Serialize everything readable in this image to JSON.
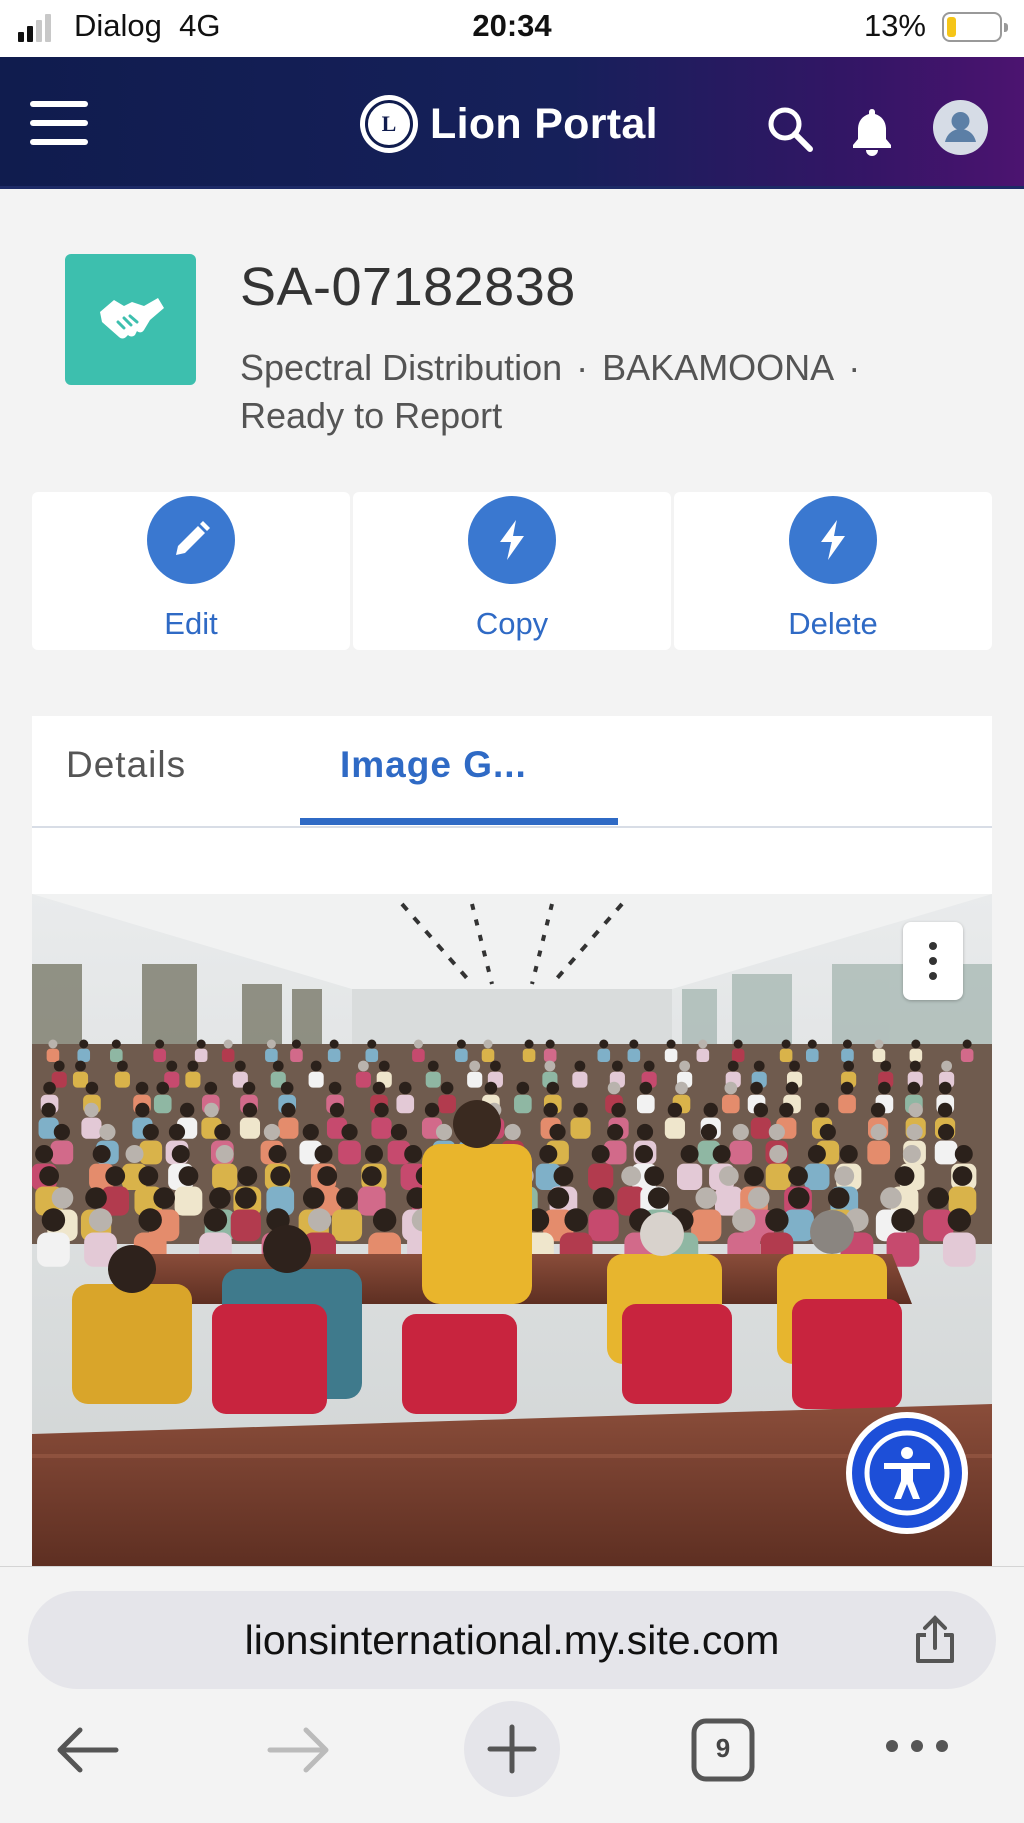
{
  "status_bar": {
    "carrier": "Dialog",
    "network": "4G",
    "time": "20:34",
    "battery": "13%",
    "battery_level": 0.13
  },
  "header": {
    "title": "Lion Portal",
    "logo_letter": "L",
    "icons": [
      "menu-icon",
      "search-icon",
      "bell-icon",
      "user-avatar-icon"
    ]
  },
  "record": {
    "icon": "handshake-icon",
    "icon_color": "#3dbfae",
    "id": "SA-07182838",
    "type": "Spectral Distribution",
    "location": "BAKAMOONA",
    "status": "Ready to Report",
    "separator": "·"
  },
  "actions": [
    {
      "label": "Edit",
      "icon": "pencil-icon"
    },
    {
      "label": "Copy",
      "icon": "lightning-icon"
    },
    {
      "label": "Delete",
      "icon": "lightning-icon"
    }
  ],
  "tabs": [
    {
      "label": "Details",
      "active": false
    },
    {
      "label": "Image G...",
      "active": true
    }
  ],
  "gallery": {
    "image_alt": "Group photo in a hall with seated audience and Lions members at a front table",
    "menu_icon": "more-vertical-icon"
  },
  "accessibility_button": {
    "icon": "accessibility-icon"
  },
  "browser": {
    "url": "lionsinternational.my.site.com",
    "tab_count": "9",
    "icons": [
      "back-icon",
      "forward-icon",
      "new-tab-icon",
      "tabs-icon",
      "more-icon",
      "share-icon"
    ]
  },
  "colors": {
    "header_start": "#101c4e",
    "header_end": "#4c1470",
    "accent": "#2f6ac5",
    "action_circle": "#3a78d0",
    "a11y_blue": "#1d4fd8"
  }
}
